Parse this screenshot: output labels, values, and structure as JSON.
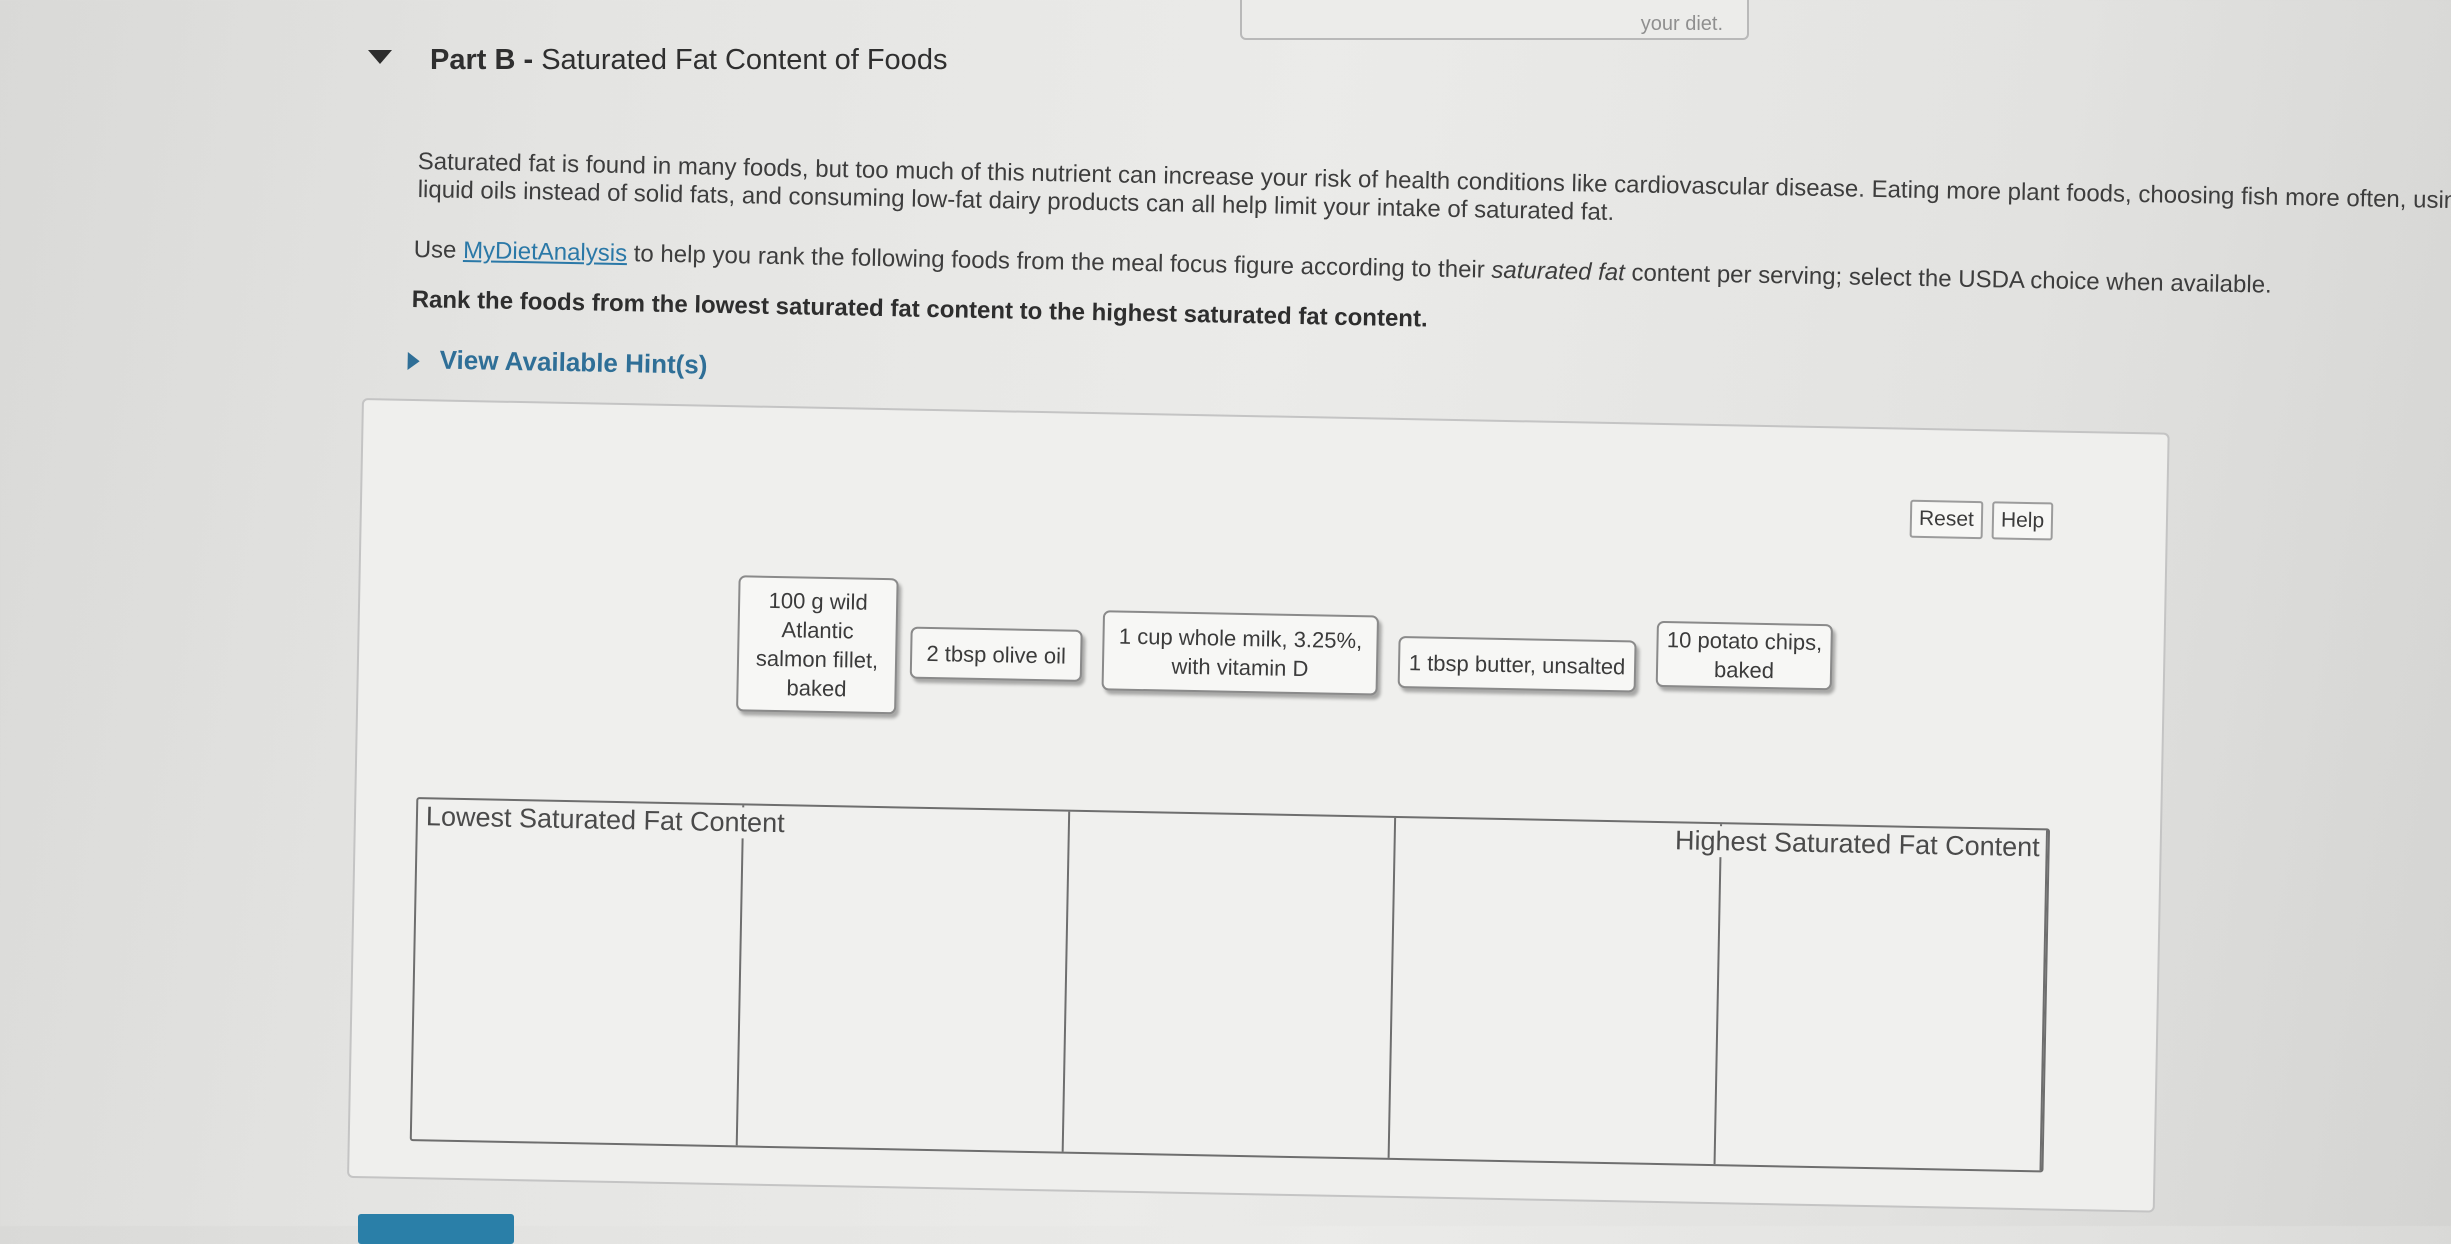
{
  "page": {
    "top_box_text": "your diet.",
    "part_label": "Part B",
    "part_separator": " - ",
    "part_title": "Saturated Fat Content of Foods",
    "intro_line1": "Saturated fat is found in many foods, but too much of this nutrient can increase your risk of health conditions like cardiovascular disease. Eating more plant foods, choosing fish more often, usin",
    "intro_line2": "liquid oils instead of solid fats, and consuming low-fat dairy products can all help limit your intake of saturated fat.",
    "use_prefix": "Use ",
    "use_link": "MyDietAnalysis",
    "use_middle": " to help you rank the following foods from the meal focus figure according to their ",
    "use_italic": "saturated fat",
    "use_suffix": " content per serving; select the USDA choice when available.",
    "instruction": "Rank the foods from the lowest saturated fat content to the highest saturated fat content.",
    "hint_label": "View Available Hint(s)"
  },
  "toolbar": {
    "reset_label": "Reset",
    "help_label": "Help"
  },
  "foods": [
    "100 g wild Atlantic salmon fillet, baked",
    "2 tbsp olive oil",
    "1 cup whole milk, 3.25%, with vitamin D",
    "1 tbsp butter, unsalted",
    "10 potato chips, baked"
  ],
  "ranking": {
    "lowest_label": "Lowest Saturated Fat Content",
    "highest_label": "Highest Saturated Fat Content",
    "slots": 5
  },
  "colors": {
    "link": "#2a78a7",
    "hint": "#2f6f97",
    "submit_button": "#2a7fa8"
  }
}
